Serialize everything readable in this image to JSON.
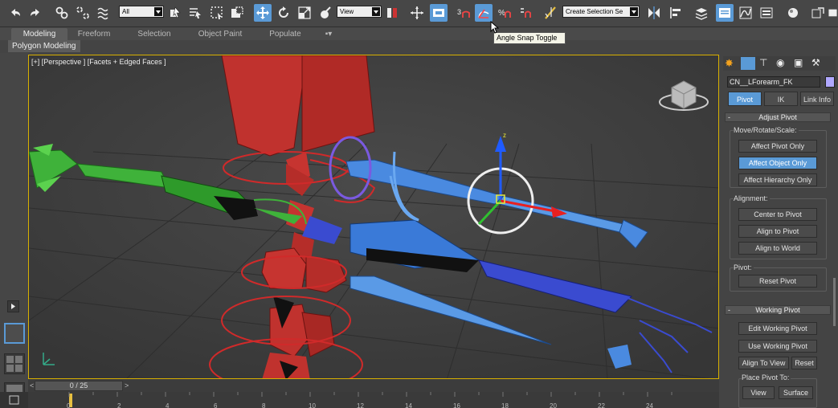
{
  "toolbar": {
    "selection_filter": "All",
    "reference_coord": "View",
    "named_selection": "Create Selection Se",
    "icons": [
      "undo-icon",
      "redo-icon",
      "select-link-icon",
      "unlink-icon",
      "bind-spacewarp-icon",
      "select-object-icon",
      "select-by-name-icon",
      "rectangle-selection-icon",
      "window-crossing-icon",
      "select-move-icon",
      "select-rotate-icon",
      "select-scale-icon",
      "select-place-icon",
      "pivot-center-icon",
      "select-manipulate-icon",
      "keyboard-shortcut-icon",
      "snaps-toggle-icon",
      "angle-snap-icon",
      "percent-snap-icon",
      "spinner-snap-icon",
      "edit-named-sets-icon",
      "mirror-icon",
      "align-icon",
      "layer-explorer-icon",
      "scene-explorer-icon",
      "curve-editor-icon",
      "schematic-view-icon",
      "material-editor-icon",
      "render-setup-icon",
      "rendered-frame-icon"
    ],
    "tooltip": "Angle Snap Toggle",
    "accent": "#5a9ad6"
  },
  "ribbon": {
    "tabs": [
      "Modeling",
      "Freeform",
      "Selection",
      "Object Paint",
      "Populate"
    ],
    "active_tab": "Modeling",
    "subtab": "Polygon Modeling"
  },
  "viewport": {
    "label": "[+] [Perspective ] [Facets + Edged Faces ]",
    "border_color": "#d8b000"
  },
  "command_panel": {
    "object_name": "CN__LForearm_FK",
    "object_color": "#b0a8ff",
    "tabs": [
      "Pivot",
      "IK",
      "Link Info"
    ],
    "active_tab": "Pivot",
    "adjust_pivot": {
      "title": "Adjust Pivot",
      "move_group": "Move/Rotate/Scale:",
      "affect_pivot": "Affect Pivot Only",
      "affect_object": "Affect Object Only",
      "affect_hierarchy": "Affect Hierarchy Only",
      "alignment_group": "Alignment:",
      "center_to_pivot": "Center to Pivot",
      "align_to_pivot": "Align to Pivot",
      "align_to_world": "Align to World",
      "pivot_group": "Pivot:",
      "reset_pivot": "Reset Pivot"
    },
    "working_pivot": {
      "title": "Working Pivot",
      "edit": "Edit Working Pivot",
      "use": "Use Working Pivot",
      "align_to_view": "Align To View",
      "reset": "Reset",
      "place_group": "Place Pivot To:",
      "view": "View",
      "surface": "Surface"
    }
  },
  "timeline": {
    "frame_label": "0 / 25",
    "ticks": [
      "0",
      "2",
      "4",
      "6",
      "8",
      "10",
      "12",
      "14",
      "16",
      "18",
      "20",
      "22",
      "24"
    ]
  }
}
